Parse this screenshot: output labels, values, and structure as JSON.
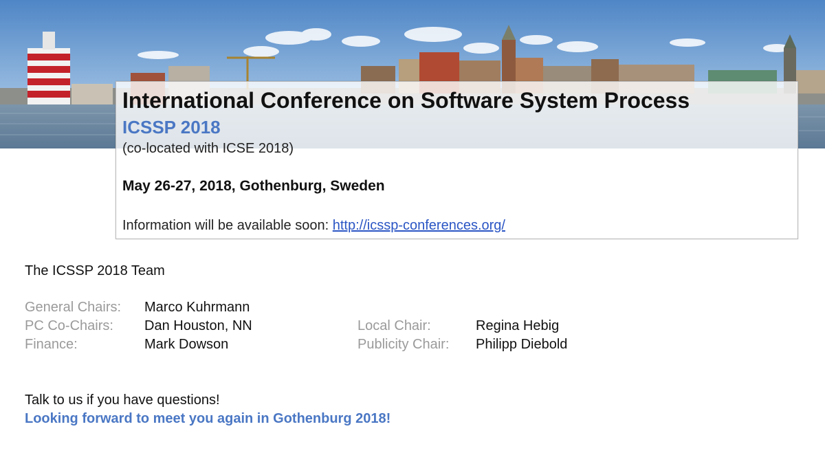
{
  "colors": {
    "accent": "#4a77c4",
    "link": "#2a55c4",
    "muted_label": "#9a9a9a",
    "text": "#111111"
  },
  "banner": {
    "icon": "gothenburg-harbor-skyline-photo"
  },
  "conference": {
    "title": "International Conference on Software System Process",
    "acronym": "ICSSP 2018",
    "colocated": "(co-located with ICSE 2018)",
    "dates": "May 26-27, 2018, Gothenburg, Sweden",
    "info_prefix": "Information will be available soon: ",
    "info_link": "http://icssp-conferences.org/"
  },
  "team": {
    "heading": "The ICSSP 2018 Team",
    "roles": [
      {
        "label": "General Chairs:",
        "name": "Marco Kuhrmann"
      },
      {
        "label": "PC Co-Chairs:",
        "name": "Dan Houston, NN"
      },
      {
        "label": "Finance:",
        "name": "Mark Dowson"
      },
      {
        "label": "Local Chair:",
        "name": "Regina Hebig"
      },
      {
        "label": "Publicity Chair:",
        "name": "Philipp Diebold"
      }
    ]
  },
  "footer": {
    "contact": "Talk to us if you have questions!",
    "closing": "Looking forward to meet you again in Gothenburg 2018!"
  }
}
